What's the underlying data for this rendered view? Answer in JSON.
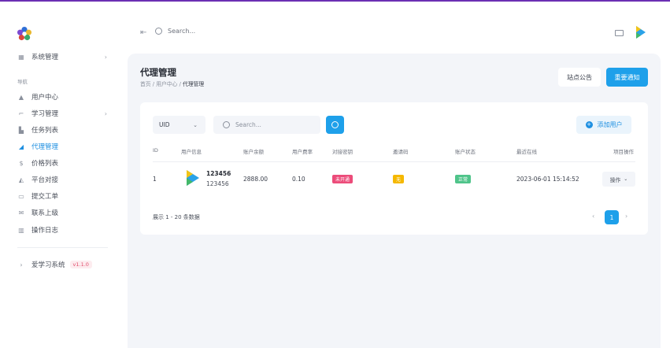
{
  "sidebar": {
    "top_item": {
      "label": "系统管理",
      "icon": "grid-icon"
    },
    "section_label": "导航",
    "items": [
      {
        "label": "用户中心",
        "icon": "user-icon",
        "active": false
      },
      {
        "label": "学习管理",
        "icon": "book-icon",
        "active": false
      },
      {
        "label": "任务列表",
        "icon": "list-icon",
        "active": false
      },
      {
        "label": "代理管理",
        "icon": "agent-icon",
        "active": true
      },
      {
        "label": "价格列表",
        "icon": "dollar-icon",
        "active": false
      },
      {
        "label": "平台对接",
        "icon": "link-icon",
        "active": false
      },
      {
        "label": "提交工单",
        "icon": "ticket-icon",
        "active": false
      },
      {
        "label": "联系上级",
        "icon": "mail-icon",
        "active": false
      },
      {
        "label": "操作日志",
        "icon": "log-icon",
        "active": false
      }
    ],
    "app_name": "爱学习系统",
    "version": "v1.1.0"
  },
  "header": {
    "search_placeholder": "Search..."
  },
  "page": {
    "title": "代理管理",
    "breadcrumb": [
      "首页",
      "用户中心",
      "代理管理"
    ],
    "btn_notice": "站点公告",
    "btn_important": "重要通知"
  },
  "filters": {
    "select_value": "UID",
    "search_placeholder": "Search...",
    "add_user_label": "添加用户"
  },
  "table": {
    "headers": [
      "ID",
      "用户信息",
      "账户余额",
      "用户费率",
      "对接密钥",
      "邀请码",
      "账户状态",
      "最近在线",
      "项目操作"
    ],
    "rows": [
      {
        "id": "1",
        "name": "123456",
        "account": "123456",
        "balance": "2888.00",
        "rate": "0.10",
        "key_status": "未开通",
        "invite_code": "无",
        "status": "正常",
        "last_online": "2023-06-01 15:14:52",
        "action": "操作"
      }
    ]
  },
  "pagination": {
    "info": "展示 1 - 20 条数据",
    "current": "1"
  },
  "colors": {
    "accent": "#1ea0ea",
    "badge_red": "#ec4c7a",
    "badge_yellow": "#f5b800",
    "badge_green": "#4fc48a"
  }
}
